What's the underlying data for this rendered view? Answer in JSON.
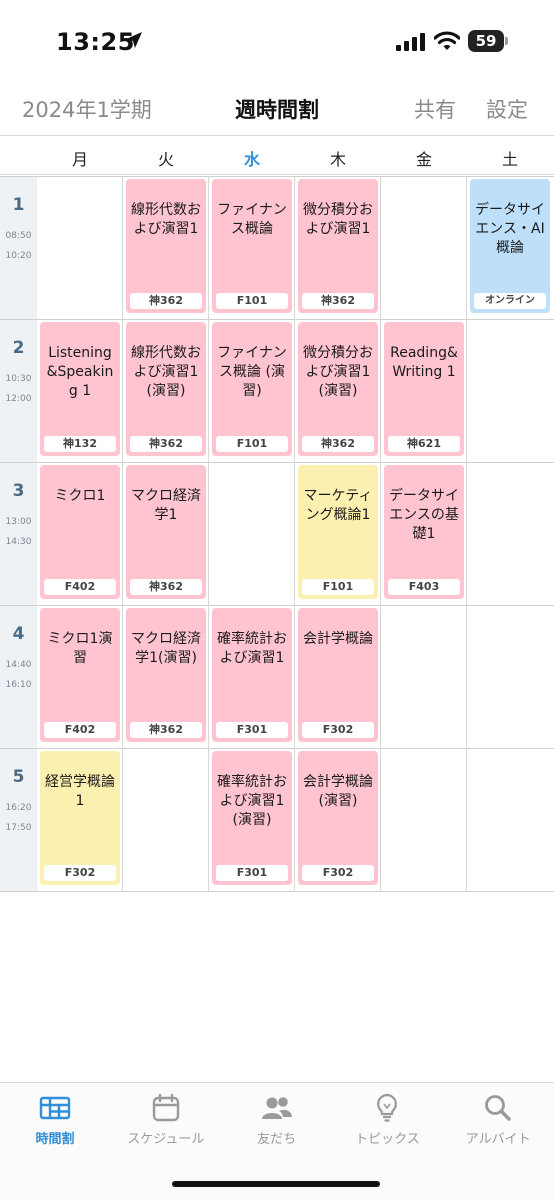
{
  "status_bar": {
    "time": "13:25",
    "battery": "59"
  },
  "header": {
    "term": "2024年1学期",
    "title": "週時間割",
    "share": "共有",
    "settings": "設定"
  },
  "days": [
    "月",
    "火",
    "水",
    "木",
    "金",
    "土"
  ],
  "today_index": 2,
  "periods": [
    {
      "num": "1",
      "start": "08:50",
      "end": "10:20"
    },
    {
      "num": "2",
      "start": "10:30",
      "end": "12:00"
    },
    {
      "num": "3",
      "start": "13:00",
      "end": "14:30"
    },
    {
      "num": "4",
      "start": "14:40",
      "end": "16:10"
    },
    {
      "num": "5",
      "start": "16:20",
      "end": "17:50"
    }
  ],
  "classes": [
    {
      "period": 0,
      "day": 1,
      "name": "線形代数および演習1",
      "room": "神362",
      "color": "pink"
    },
    {
      "period": 0,
      "day": 2,
      "name": "ファイナンス概論",
      "room": "F101",
      "color": "pink"
    },
    {
      "period": 0,
      "day": 3,
      "name": "微分積分および演習1",
      "room": "神362",
      "color": "pink"
    },
    {
      "period": 0,
      "day": 5,
      "name": "データサイエンス・AI概論",
      "room": "オンライン",
      "color": "blue"
    },
    {
      "period": 1,
      "day": 0,
      "name": "Listening&Speaking 1",
      "room": "神132",
      "color": "pink"
    },
    {
      "period": 1,
      "day": 1,
      "name": "線形代数および演習1(演習)",
      "room": "神362",
      "color": "pink"
    },
    {
      "period": 1,
      "day": 2,
      "name": "ファイナンス概論 (演習)",
      "room": "F101",
      "color": "pink"
    },
    {
      "period": 1,
      "day": 3,
      "name": "微分積分および演習1(演習)",
      "room": "神362",
      "color": "pink"
    },
    {
      "period": 1,
      "day": 4,
      "name": "Reading&Writing 1",
      "room": "神621",
      "color": "pink"
    },
    {
      "period": 2,
      "day": 0,
      "name": "ミクロ1",
      "room": "F402",
      "color": "pink"
    },
    {
      "period": 2,
      "day": 1,
      "name": "マクロ経済学1",
      "room": "神362",
      "color": "pink"
    },
    {
      "period": 2,
      "day": 3,
      "name": "マーケティング概論1",
      "room": "F101",
      "color": "yellow"
    },
    {
      "period": 2,
      "day": 4,
      "name": "データサイエンスの基礎1",
      "room": "F403",
      "color": "pink"
    },
    {
      "period": 3,
      "day": 0,
      "name": "ミクロ1演習",
      "room": "F402",
      "color": "pink"
    },
    {
      "period": 3,
      "day": 1,
      "name": "マクロ経済学1(演習)",
      "room": "神362",
      "color": "pink"
    },
    {
      "period": 3,
      "day": 2,
      "name": "確率統計および演習1",
      "room": "F301",
      "color": "pink"
    },
    {
      "period": 3,
      "day": 3,
      "name": "会計学概論",
      "room": "F302",
      "color": "pink"
    },
    {
      "period": 4,
      "day": 0,
      "name": "経営学概論1",
      "room": "F302",
      "color": "yellow"
    },
    {
      "period": 4,
      "day": 2,
      "name": "確率統計および演習1(演習)",
      "room": "F301",
      "color": "pink"
    },
    {
      "period": 4,
      "day": 3,
      "name": "会計学概論 (演習)",
      "room": "F302",
      "color": "pink"
    }
  ],
  "tabs": [
    {
      "label": "時間割",
      "icon": "timetable-icon",
      "active": true
    },
    {
      "label": "スケジュール",
      "icon": "calendar-icon",
      "active": false
    },
    {
      "label": "友だち",
      "icon": "friends-icon",
      "active": false
    },
    {
      "label": "トピックス",
      "icon": "lightbulb-icon",
      "active": false
    },
    {
      "label": "アルバイト",
      "icon": "search-icon",
      "active": false
    }
  ],
  "colors": {
    "pink": "#ffc4d0",
    "yellow": "#fcf0b0",
    "blue": "#bedffa",
    "accent": "#2f8fd8"
  }
}
